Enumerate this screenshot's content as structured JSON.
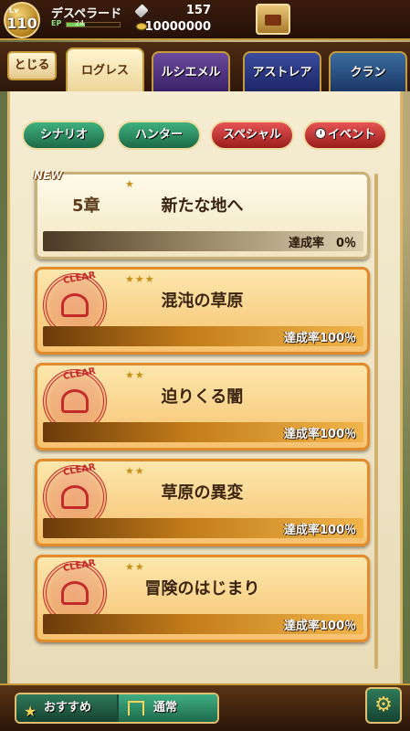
{
  "player": {
    "lv_prefix": "Lv",
    "level": "110",
    "name": "デスペラード",
    "ep_label": "EP",
    "ep_value": "24",
    "ep_fill": 0.35,
    "gems": "157",
    "gold": "10000000"
  },
  "header": {
    "close_label": "とじる",
    "tabs": [
      {
        "label": "ログレス",
        "active": true
      },
      {
        "label": "ルシエメル",
        "active": false
      },
      {
        "label": "アストレア",
        "active": false
      },
      {
        "label": "クラン",
        "active": false
      }
    ]
  },
  "categories": [
    {
      "label": "シナリオ"
    },
    {
      "label": "ハンター"
    },
    {
      "label": "スペシャル"
    },
    {
      "label": "イベント"
    }
  ],
  "chapters": [
    {
      "badge": "NEW",
      "number": "5章",
      "stars": "★",
      "title": "新たな地へ",
      "progress": "達成率　0％",
      "cleared": false
    },
    {
      "stamp": "CLEAR",
      "stars": "★★★",
      "title": "混沌の草原",
      "progress": "達成率100％",
      "cleared": true
    },
    {
      "stamp": "CLEAR",
      "stars": "★★",
      "title": "迫りくる闇",
      "progress": "達成率100％",
      "cleared": true
    },
    {
      "stamp": "CLEAR",
      "stars": "★★",
      "title": "草原の異変",
      "progress": "達成率100％",
      "cleared": true
    },
    {
      "stamp": "CLEAR",
      "stars": "★★",
      "title": "冒険のはじまり",
      "progress": "達成率100％",
      "cleared": true
    }
  ],
  "footer": {
    "recommend_label": "おすすめ",
    "normal_label": "通常"
  },
  "colors": {
    "scenario": "#1d6a47",
    "special": "#9a1c1c",
    "clear_stamp": "#c32b2b",
    "progress_cleared": "#c27c1a"
  },
  "icons": {
    "gem": "gem-icon",
    "gold": "gold-icon",
    "menu": "book-icon",
    "event": "clock-icon",
    "recommend": "star-icon",
    "normal": "gate-icon",
    "settings": "gear-icon"
  }
}
